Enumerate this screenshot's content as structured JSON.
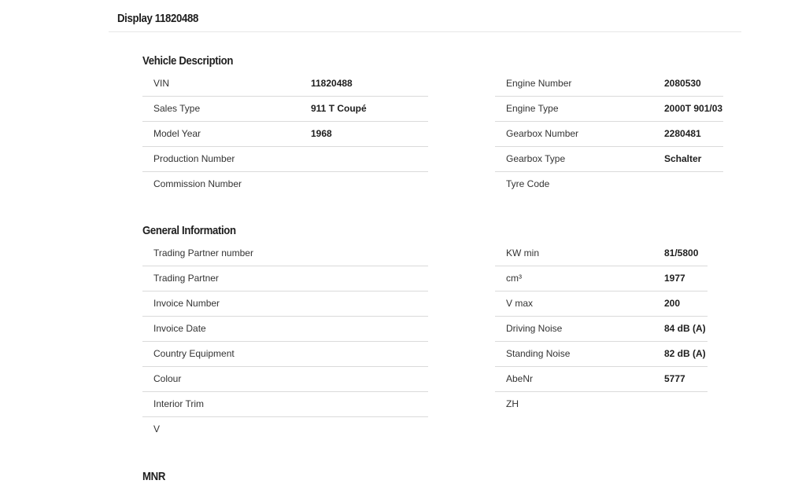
{
  "page": {
    "title": "Display 11820488"
  },
  "vehicle_description": {
    "title": "Vehicle Description",
    "left": [
      {
        "label": "VIN",
        "value": "11820488"
      },
      {
        "label": "Sales Type",
        "value": "911 T Coupé"
      },
      {
        "label": "Model Year",
        "value": "1968"
      },
      {
        "label": "Production Number",
        "value": ""
      },
      {
        "label": "Commission Number",
        "value": ""
      }
    ],
    "right": [
      {
        "label": "Engine Number",
        "value": "2080530"
      },
      {
        "label": "Engine Type",
        "value": "2000T 901/03"
      },
      {
        "label": "Gearbox Number",
        "value": "2280481"
      },
      {
        "label": "Gearbox Type",
        "value": "Schalter"
      },
      {
        "label": "Tyre Code",
        "value": ""
      }
    ]
  },
  "general_information": {
    "title": "General Information",
    "left": [
      {
        "label": "Trading Partner number",
        "value": ""
      },
      {
        "label": "Trading Partner",
        "value": ""
      },
      {
        "label": "Invoice Number",
        "value": ""
      },
      {
        "label": "Invoice Date",
        "value": ""
      },
      {
        "label": "Country Equipment",
        "value": ""
      },
      {
        "label": "Colour",
        "value": ""
      },
      {
        "label": "Interior Trim",
        "value": ""
      },
      {
        "label": "V",
        "value": ""
      }
    ],
    "right": [
      {
        "label": "KW min",
        "value": "81/5800"
      },
      {
        "label": "cm³",
        "value": "1977"
      },
      {
        "label": "V max",
        "value": "200"
      },
      {
        "label": "Driving Noise",
        "value": "84 dB (A)"
      },
      {
        "label": "Standing Noise",
        "value": "82 dB (A)"
      },
      {
        "label": "AbeNr",
        "value": "5777"
      },
      {
        "label": "ZH",
        "value": ""
      }
    ]
  },
  "mnr": {
    "title": "MNR"
  }
}
